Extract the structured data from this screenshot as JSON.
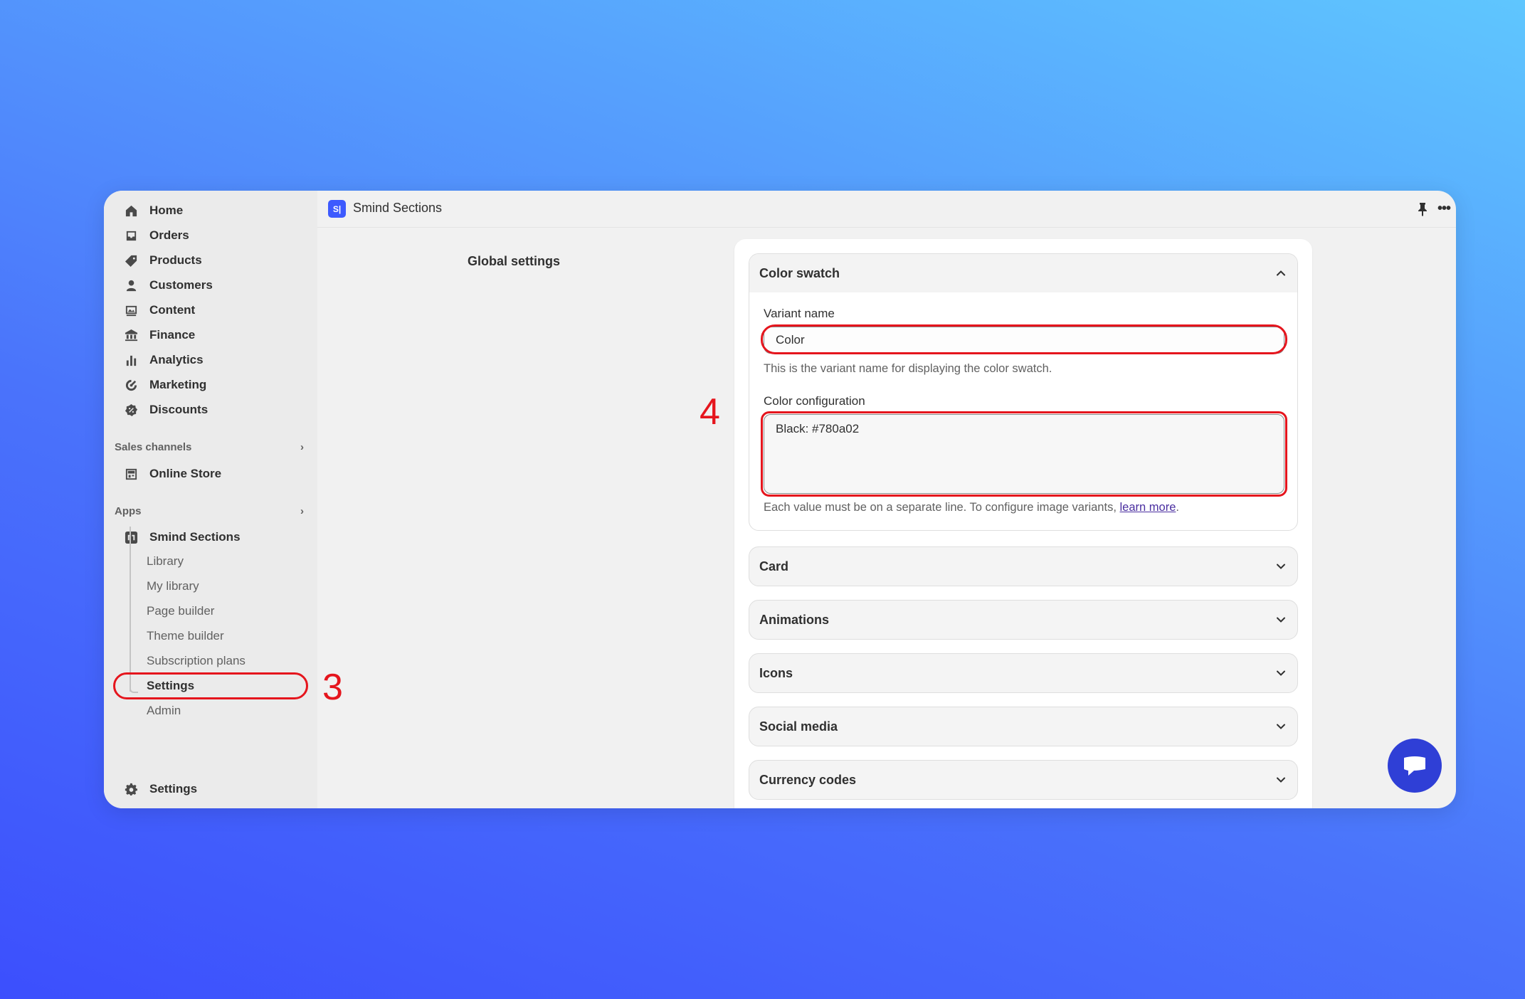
{
  "sidebar": {
    "nav": [
      {
        "label": "Home",
        "icon": "home-icon"
      },
      {
        "label": "Orders",
        "icon": "inbox-icon"
      },
      {
        "label": "Products",
        "icon": "tag-icon"
      },
      {
        "label": "Customers",
        "icon": "person-icon"
      },
      {
        "label": "Content",
        "icon": "image-icon"
      },
      {
        "label": "Finance",
        "icon": "bank-icon"
      },
      {
        "label": "Analytics",
        "icon": "bar-chart-icon"
      },
      {
        "label": "Marketing",
        "icon": "target-icon"
      },
      {
        "label": "Discounts",
        "icon": "discount-icon"
      }
    ],
    "sales_channels_label": "Sales channels",
    "online_store_label": "Online Store",
    "apps_label": "Apps",
    "app_name": "Smind Sections",
    "app_sub_items": [
      "Library",
      "My library",
      "Page builder",
      "Theme builder",
      "Subscription plans",
      "Settings",
      "Admin"
    ],
    "bottom_settings_label": "Settings"
  },
  "topbar": {
    "app_logo_text": "S|",
    "app_title": "Smind Sections"
  },
  "page": {
    "heading": "Global settings"
  },
  "color_swatch": {
    "title": "Color swatch",
    "variant_name_label": "Variant name",
    "variant_name_value": "Color",
    "variant_name_help": "This is the variant name for displaying the color swatch.",
    "color_config_label": "Color configuration",
    "color_config_value": "Black: #780a02",
    "color_config_help": "Each value must be on a separate line. To configure image variants, ",
    "learn_more": "learn more",
    "help_end": "."
  },
  "accordions": [
    "Card",
    "Animations",
    "Icons",
    "Social media",
    "Currency codes"
  ],
  "annotations": {
    "step3": "3",
    "step4": "4",
    "color": "#e5151d"
  },
  "colors": {
    "accent": "#3d5afe",
    "chat_button": "#2f3fd6"
  }
}
